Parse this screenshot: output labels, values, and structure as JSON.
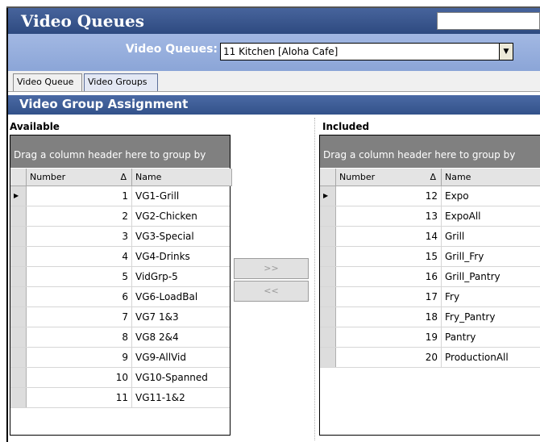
{
  "window": {
    "title": "Video Queues"
  },
  "selector": {
    "label": "Video Queues:",
    "value": "11 Kitchen [Aloha Cafe]"
  },
  "tabs": [
    {
      "label": "Video Queue"
    },
    {
      "label": "Video Groups"
    }
  ],
  "section": {
    "title": "Video Group Assignment"
  },
  "available": {
    "label": "Available",
    "group_hint": "Drag a column header here to group by",
    "columns": {
      "number": "Number",
      "name": "Name",
      "sort_glyph": "Δ"
    },
    "rows": [
      {
        "number": "1",
        "name": "VG1-Grill"
      },
      {
        "number": "2",
        "name": "VG2-Chicken"
      },
      {
        "number": "3",
        "name": "VG3-Special"
      },
      {
        "number": "4",
        "name": "VG4-Drinks"
      },
      {
        "number": "5",
        "name": "VidGrp-5"
      },
      {
        "number": "6",
        "name": "VG6-LoadBal"
      },
      {
        "number": "7",
        "name": "VG7 1&3"
      },
      {
        "number": "8",
        "name": "VG8 2&4"
      },
      {
        "number": "9",
        "name": "VG9-AllVid"
      },
      {
        "number": "10",
        "name": "VG10-Spanned"
      },
      {
        "number": "11",
        "name": "VG11-1&2"
      }
    ]
  },
  "included": {
    "label": "Included",
    "group_hint": "Drag a column header here to group by",
    "columns": {
      "number": "Number",
      "name": "Name",
      "sort_glyph": "Δ"
    },
    "rows": [
      {
        "number": "12",
        "name": "Expo"
      },
      {
        "number": "13",
        "name": "ExpoAll"
      },
      {
        "number": "14",
        "name": "Grill"
      },
      {
        "number": "15",
        "name": "Grill_Fry"
      },
      {
        "number": "16",
        "name": "Grill_Pantry"
      },
      {
        "number": "17",
        "name": "Fry"
      },
      {
        "number": "18",
        "name": "Fry_Pantry"
      },
      {
        "number": "19",
        "name": "Pantry"
      },
      {
        "number": "20",
        "name": "ProductionAll"
      }
    ]
  },
  "buttons": {
    "add": ">>",
    "remove": "<<"
  }
}
